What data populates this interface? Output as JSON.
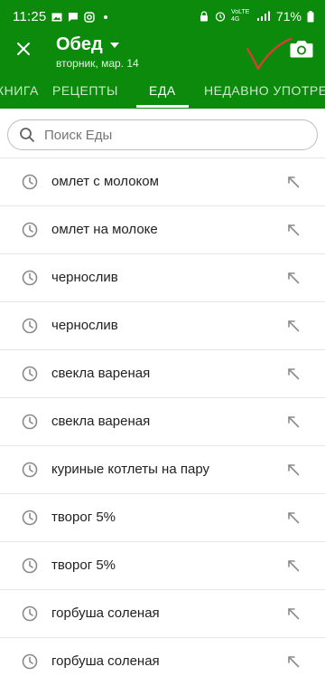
{
  "status_bar": {
    "time": "11:25",
    "network": "VoLTE 4G",
    "battery": "71%"
  },
  "app_bar": {
    "title": "Обед",
    "subtitle": "вторник, мар. 14",
    "close_icon": "close-icon",
    "camera_icon": "camera-icon"
  },
  "tabs": [
    {
      "label": "КНИГА"
    },
    {
      "label": "РЕЦЕПТЫ"
    },
    {
      "label": "ЕДА"
    },
    {
      "label": "НЕДАВНО УПОТРЕБЛ"
    }
  ],
  "active_tab": "ЕДА",
  "search": {
    "placeholder": "Поиск Еды"
  },
  "items": [
    {
      "label": "омлет с молоком"
    },
    {
      "label": "омлет на молоке"
    },
    {
      "label": "чернослив"
    },
    {
      "label": "чернослив"
    },
    {
      "label": "свекла вареная"
    },
    {
      "label": "свекла вареная"
    },
    {
      "label": "куриные котлеты на пару"
    },
    {
      "label": "творог 5%"
    },
    {
      "label": "творог 5%"
    },
    {
      "label": "горбуша соленая"
    },
    {
      "label": "горбуша соленая"
    }
  ],
  "colors": {
    "primary": "#0b8a0b",
    "annotation": "#e53935"
  }
}
